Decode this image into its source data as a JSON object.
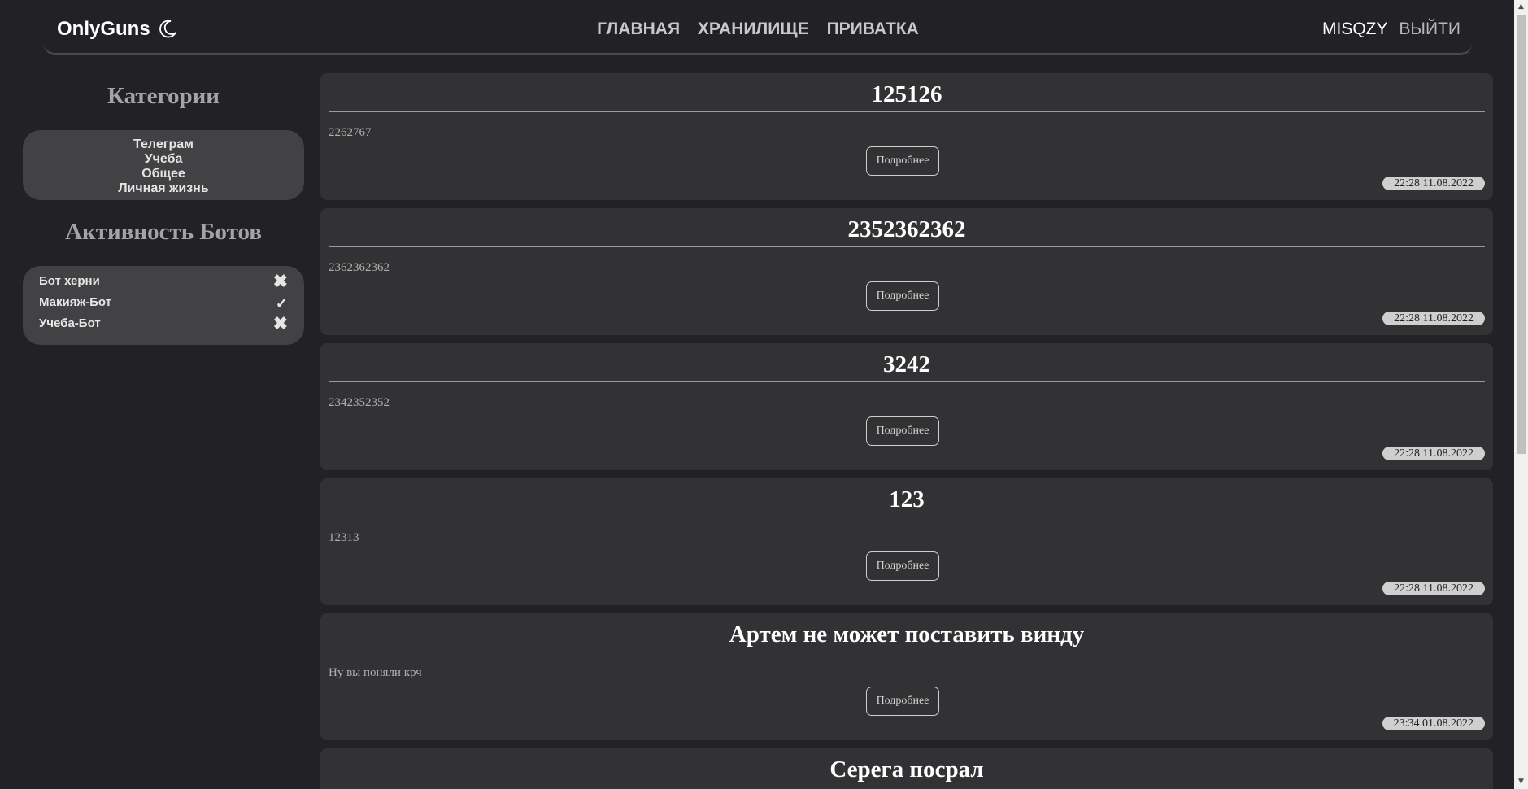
{
  "header": {
    "brand": "OnlyGuns",
    "nav": [
      "ГЛАВНАЯ",
      "ХРАНИЛИЩЕ",
      "ПРИВАТКА"
    ],
    "username": "MISQZY",
    "logout": "ВЫЙТИ"
  },
  "sidebar": {
    "categories_title": "Категории",
    "categories": [
      "Телеграм",
      "Учеба",
      "Общее",
      "Личная жизнь"
    ],
    "bots_title": "Активность Ботов",
    "bots": [
      {
        "name": "Бот херни",
        "status": "✖"
      },
      {
        "name": "Макияж-Бот",
        "status": "✓"
      },
      {
        "name": "Учеба-Бот",
        "status": "✖"
      }
    ]
  },
  "posts": [
    {
      "title": "125126",
      "body": "2262767",
      "button": "Подробнее",
      "date": "22:28 11.08.2022"
    },
    {
      "title": "2352362362",
      "body": "2362362362",
      "button": "Подробнее",
      "date": "22:28 11.08.2022"
    },
    {
      "title": "3242",
      "body": "2342352352",
      "button": "Подробнее",
      "date": "22:28 11.08.2022"
    },
    {
      "title": "123",
      "body": "12313",
      "button": "Подробнее",
      "date": "22:28 11.08.2022"
    },
    {
      "title": "Артем не может поставить винду",
      "body": "Ну вы поняли крч",
      "button": "Подробнее",
      "date": "23:34 01.08.2022"
    },
    {
      "title": "Серега посрал"
    }
  ],
  "icons": {
    "theme_toggle": "moon-icon",
    "bot_off": "cross-icon",
    "bot_on": "check-icon"
  },
  "colors": {
    "background": "#222226",
    "card": "#323234",
    "sidebar_box": "#424245"
  }
}
